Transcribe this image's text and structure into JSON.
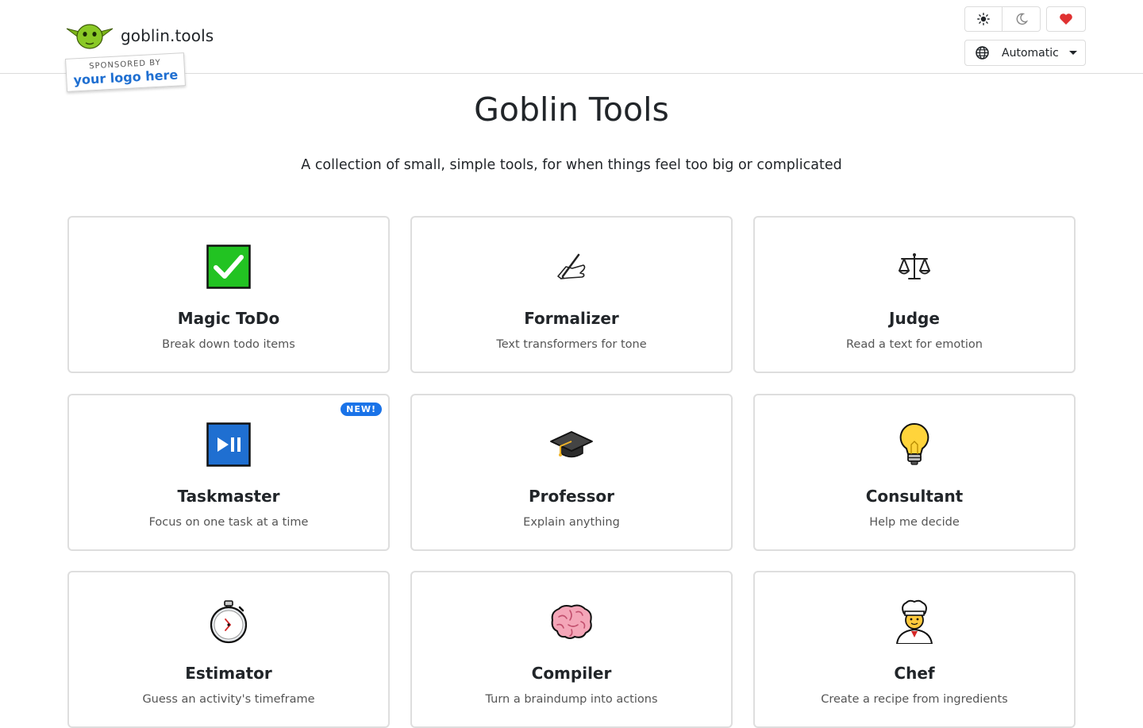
{
  "brand": {
    "name": "goblin.tools",
    "logo_icon": "goblin-head-icon"
  },
  "sponsor": {
    "top": "SPONSORED BY",
    "main": "your logo here"
  },
  "theme_buttons": {
    "light_icon": "sun-icon",
    "dark_icon": "moon-icon",
    "support_icon": "heart-icon"
  },
  "language": {
    "selected": "Automatic",
    "icon": "globe-icon"
  },
  "page": {
    "title": "Goblin Tools",
    "subtitle": "A collection of small, simple tools, for when things feel too big or complicated"
  },
  "tools": [
    {
      "name": "Magic ToDo",
      "desc": "Break down todo items",
      "icon": "checkmark-icon"
    },
    {
      "name": "Formalizer",
      "desc": "Text transformers for tone",
      "icon": "writing-hand-icon"
    },
    {
      "name": "Judge",
      "desc": "Read a text for emotion",
      "icon": "scales-icon"
    },
    {
      "name": "Taskmaster",
      "desc": "Focus on one task at a time",
      "icon": "play-pause-icon",
      "badge": "NEW!"
    },
    {
      "name": "Professor",
      "desc": "Explain anything",
      "icon": "graduation-cap-icon"
    },
    {
      "name": "Consultant",
      "desc": "Help me decide",
      "icon": "light-bulb-icon"
    },
    {
      "name": "Estimator",
      "desc": "Guess an activity's timeframe",
      "icon": "stopwatch-icon"
    },
    {
      "name": "Compiler",
      "desc": "Turn a braindump into actions",
      "icon": "brain-icon"
    },
    {
      "name": "Chef",
      "desc": "Create a recipe from ingredients",
      "icon": "chef-icon"
    }
  ],
  "colors": {
    "accent": "#1a73e8",
    "card_border": "#dedede",
    "heart": "#e03131",
    "check_green": "#22c322"
  }
}
